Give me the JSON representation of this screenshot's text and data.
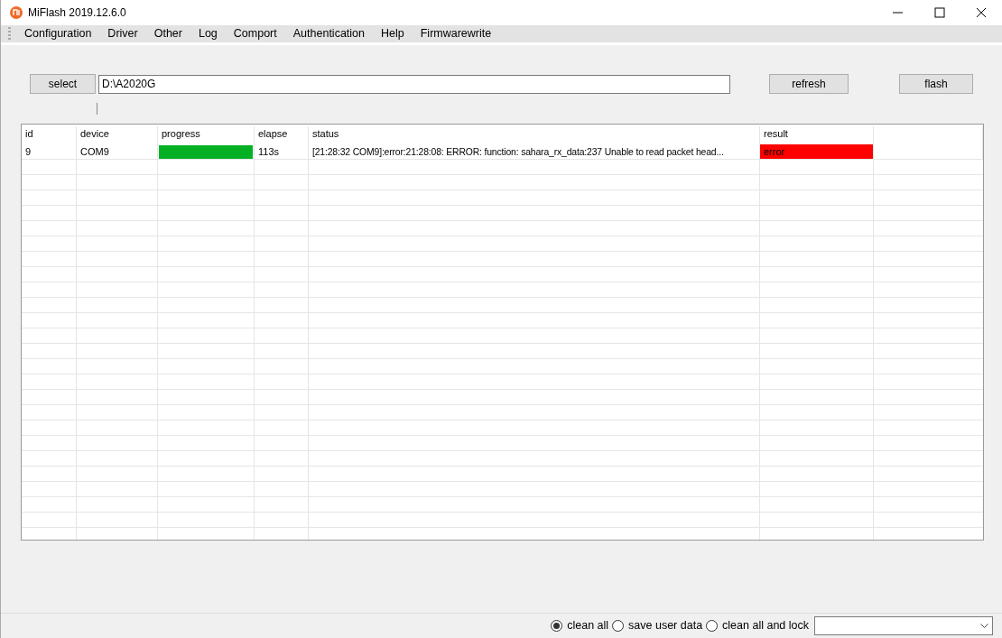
{
  "window": {
    "title": "MiFlash 2019.12.6.0"
  },
  "menu": [
    "Configuration",
    "Driver",
    "Other",
    "Log",
    "Comport",
    "Authentication",
    "Help",
    "Firmwarewrite"
  ],
  "toolbar": {
    "select_button": "select",
    "path": "D:\\A2020G",
    "refresh_button": "refresh",
    "flash_button": "flash"
  },
  "table": {
    "columns": [
      "id",
      "device",
      "progress",
      "elapse",
      "status",
      "result"
    ],
    "rows": [
      {
        "id": "9",
        "device": "COM9",
        "level": 1,
        "elapse": "113s",
        "status": "[21:28:32  COM9]:error:21:28:08: ERROR: function: sahara_rx_data:237 Unable to read packet head...",
        "result": "error",
        "color": "#ff0000"
      }
    ]
  },
  "options": [
    {
      "label": "clean all",
      "selected": true
    },
    {
      "label": "save user data",
      "selected": false
    },
    {
      "label": "clean all and lock",
      "selected": false
    }
  ]
}
